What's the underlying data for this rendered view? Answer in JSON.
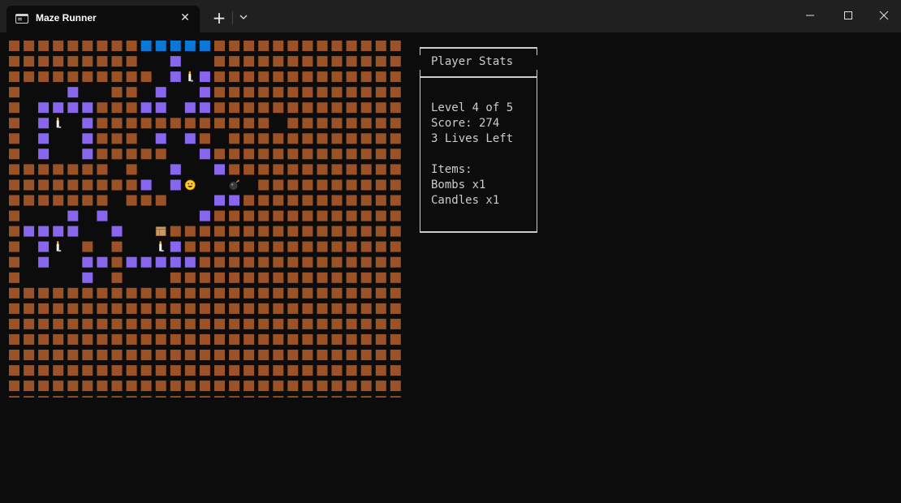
{
  "window": {
    "tab_title": "Maze Runner",
    "close_glyph": "✕",
    "newtab_glyph": "+"
  },
  "stats": {
    "header": "Player Stats",
    "level": "Level 4 of 5",
    "score": "Score: 274",
    "lives": "3 Lives Left",
    "items_label": "Items:",
    "bombs": "Bombs x1",
    "candles": "Candles x1"
  },
  "maze": {
    "colors": {
      "wall": "#9b5226",
      "lit_wall": "#8866ee",
      "exit": "#0a78d7",
      "floor": "#0c0c0c"
    },
    "legend": {
      "#": "wall",
      "P": "lit-wall",
      "B": "exit",
      ".": "floor",
      "C": "candle",
      "@": "player",
      "b": "bomb",
      "x": "crate"
    },
    "rows": [
      "#########BBBBB#############",
      "#########..P..#############",
      "##########.PCP#############",
      "#...P..##.P..P#############",
      "#.PPPP###PP.PP#############",
      "#.PC.P############.########",
      "#.P..P###.P.P#.############",
      "#.P..P#####..P#############",
      "#######.#..P..P############",
      "#########P.P@..b.##########",
      "#######.###...PP###########",
      "#...P.P......P#############",
      "#PPPP..P..x################",
      "#.PC.#.#..CP###############",
      "#.P..PP#PPPPP##############",
      "#....P.#...################",
      "###########################",
      "###########################",
      "###########################",
      "###########################",
      "###########################",
      "###########################",
      "###########################",
      "###########################"
    ]
  }
}
